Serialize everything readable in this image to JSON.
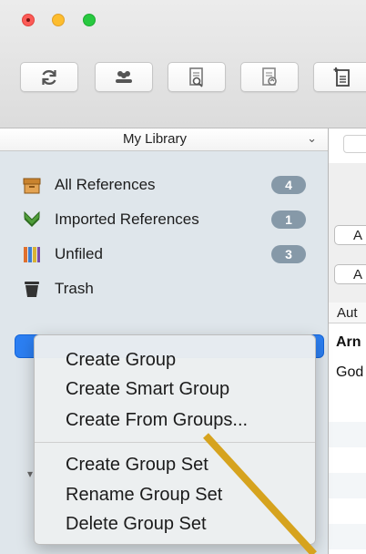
{
  "toolbar": {
    "buttons": [
      {
        "name": "refresh-icon"
      },
      {
        "name": "groups-icon"
      },
      {
        "name": "search-document-icon"
      },
      {
        "name": "edit-document-icon"
      },
      {
        "name": "new-document-icon"
      }
    ]
  },
  "sidebar": {
    "library_title": "My Library",
    "library_chevron": "⌄",
    "items": [
      {
        "label": "All References",
        "count": "4",
        "icon": "box-icon",
        "color": "#c9832e"
      },
      {
        "label": "Imported References",
        "count": "1",
        "icon": "import-arrow-icon",
        "color": "#4f9d3a"
      },
      {
        "label": "Unfiled",
        "count": "3",
        "icon": "books-icon",
        "color": "#e0702d"
      },
      {
        "label": "Trash",
        "count": "",
        "icon": "trash-icon",
        "color": "#333333"
      }
    ],
    "group_arrow": "▾"
  },
  "rightpane": {
    "buttons": [
      "A",
      "A"
    ],
    "column_header": "Aut",
    "rows": [
      "Arn",
      "God"
    ]
  },
  "context_menu": {
    "items_group1": [
      "Create Group",
      "Create Smart Group",
      "Create From Groups..."
    ],
    "items_group2": [
      "Create Group Set",
      "Rename Group Set",
      "Delete Group Set"
    ]
  },
  "colors": {
    "selection": "#2c7ff2",
    "badge": "#8699a8",
    "pointer_line": "#d6a31e"
  }
}
